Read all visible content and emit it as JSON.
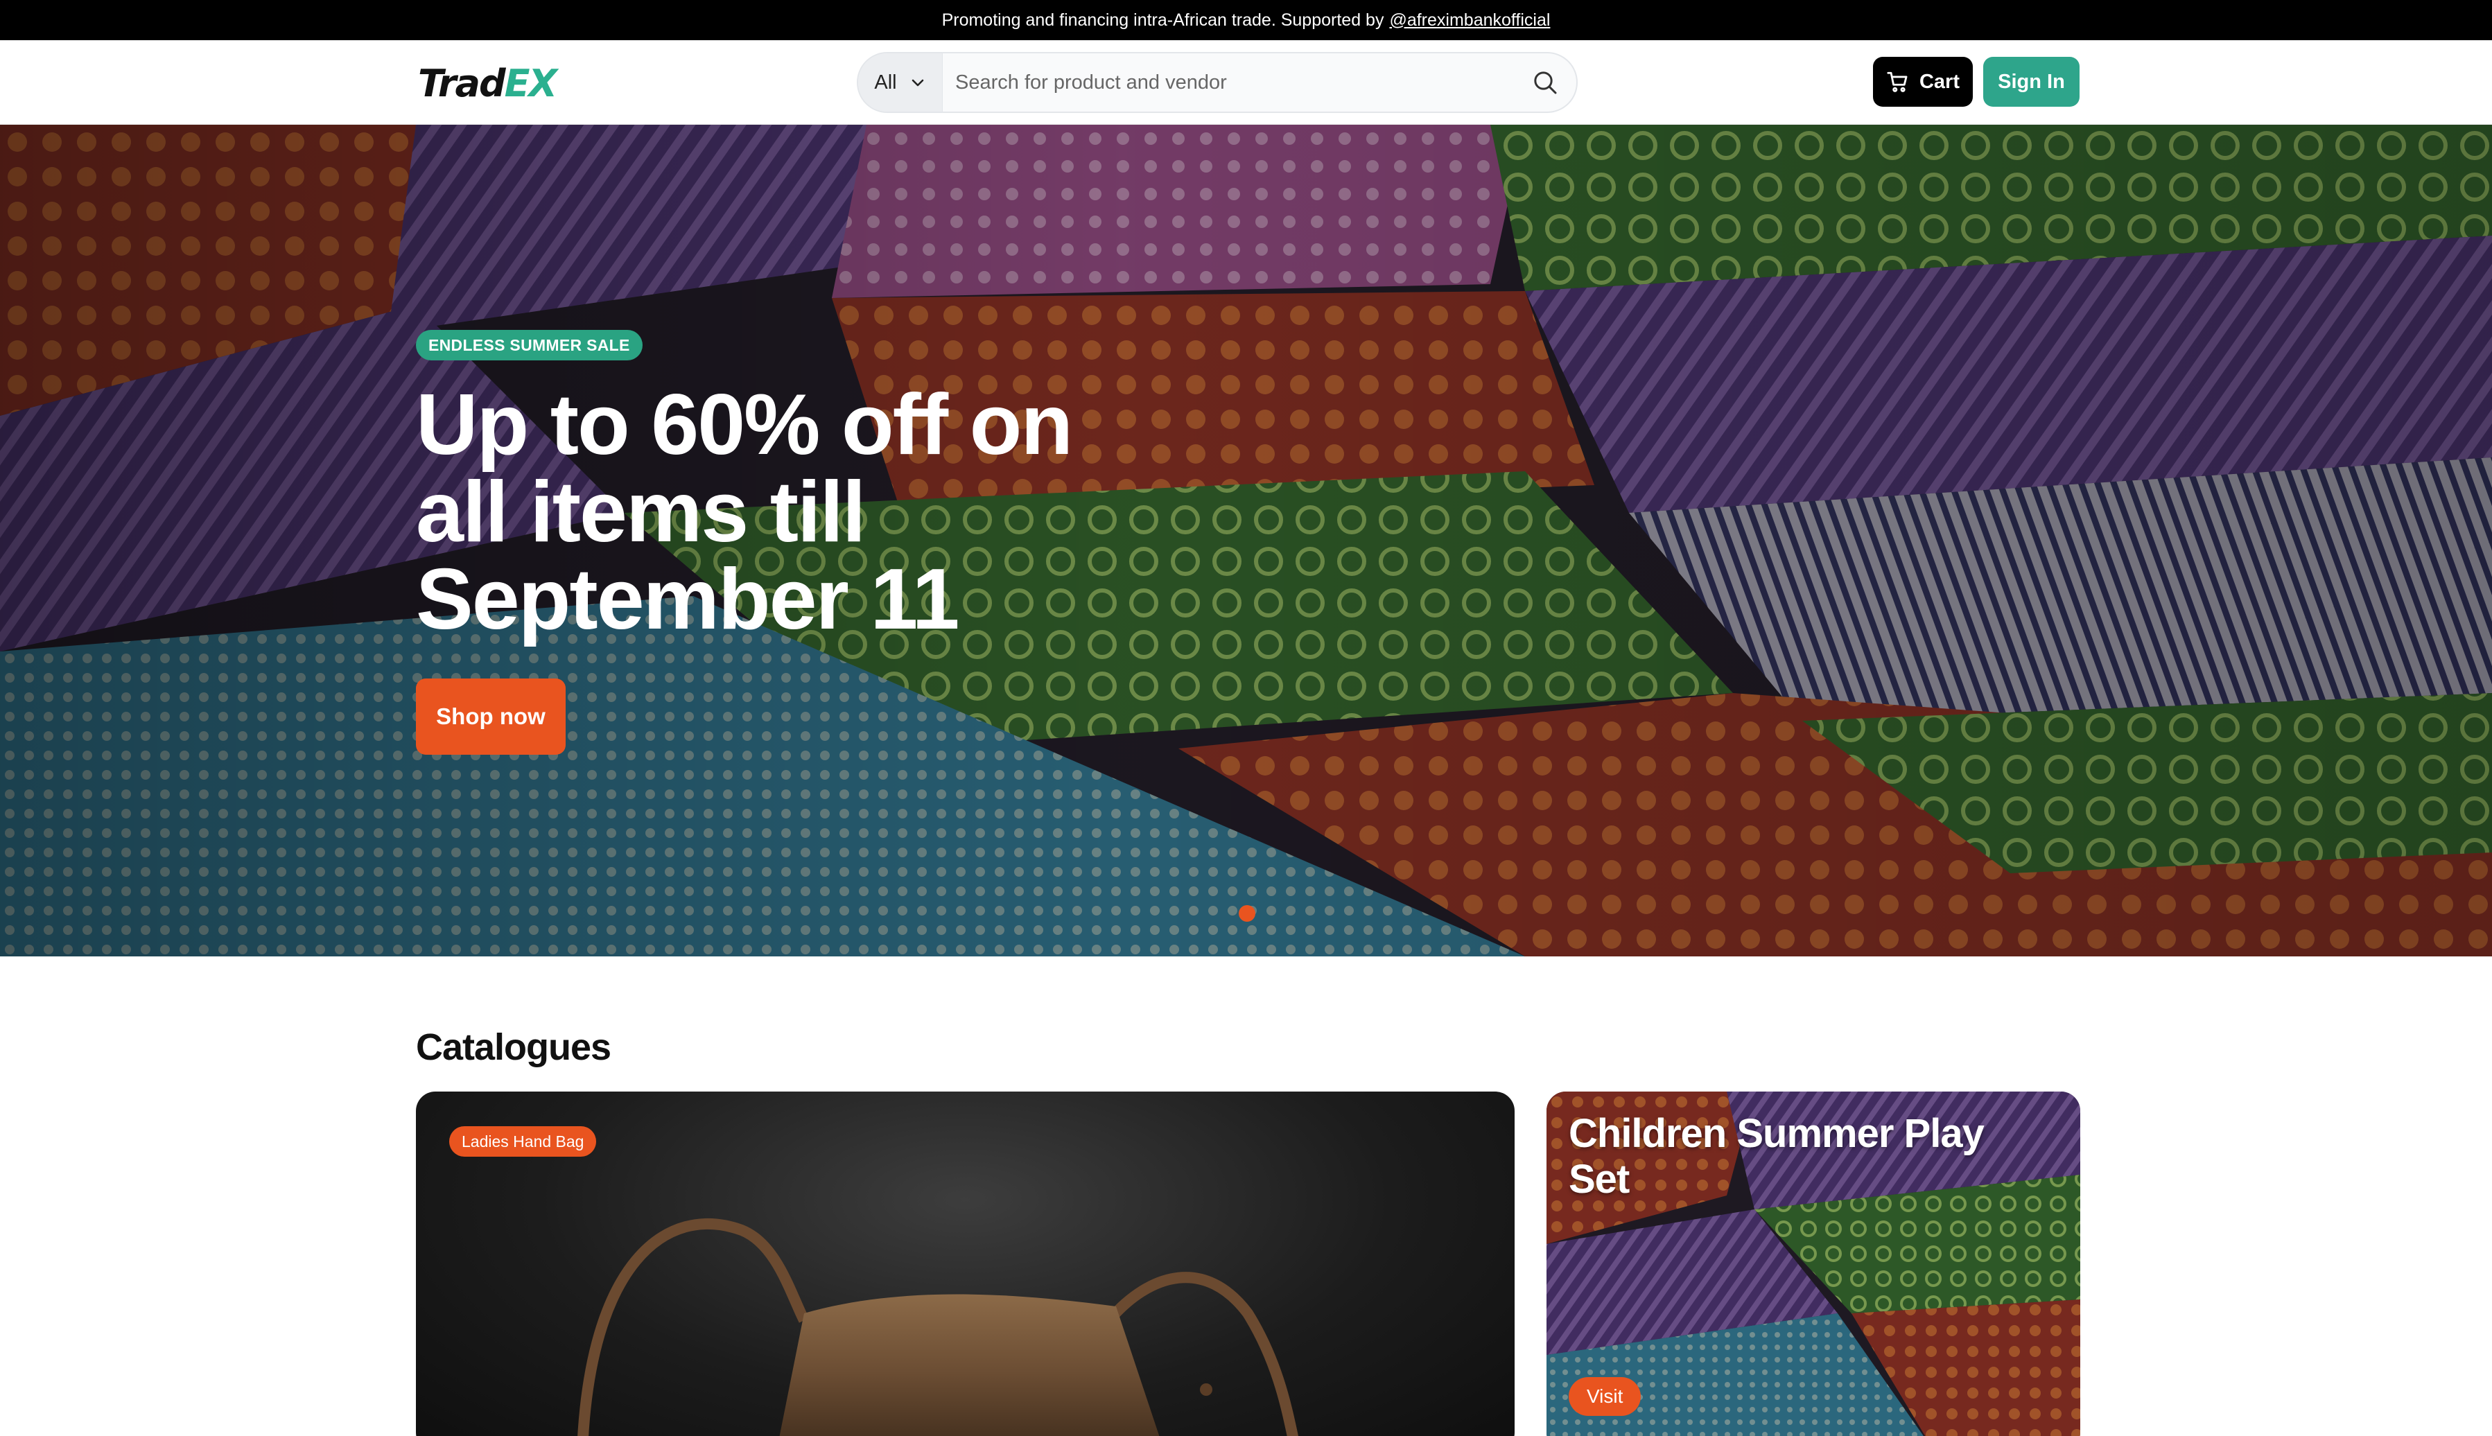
{
  "topbar": {
    "text": "Promoting and financing intra-African trade. Supported by",
    "link": "@afreximbankofficial"
  },
  "header": {
    "logo_part1": "Trad",
    "logo_part2": "EX",
    "search": {
      "category": "All",
      "placeholder": "Search for product and vendor"
    },
    "cart_label": "Cart",
    "signin_label": "Sign In"
  },
  "hero": {
    "badge": "ENDLESS SUMMER SALE",
    "headline": "Up to 60% off on all items till September 11",
    "cta": "Shop now",
    "active_slide": 1
  },
  "catalogues": {
    "title": "Catalogues",
    "items": [
      {
        "tag": "Ladies Hand Bag"
      },
      {
        "title": "Children Summer Play Set",
        "cta": "Visit"
      }
    ]
  },
  "colors": {
    "brand_green": "#2ea58b",
    "accent_orange": "#e9541f",
    "black": "#000000"
  },
  "icons": [
    "chevron-down-icon",
    "search-icon",
    "cart-icon"
  ]
}
